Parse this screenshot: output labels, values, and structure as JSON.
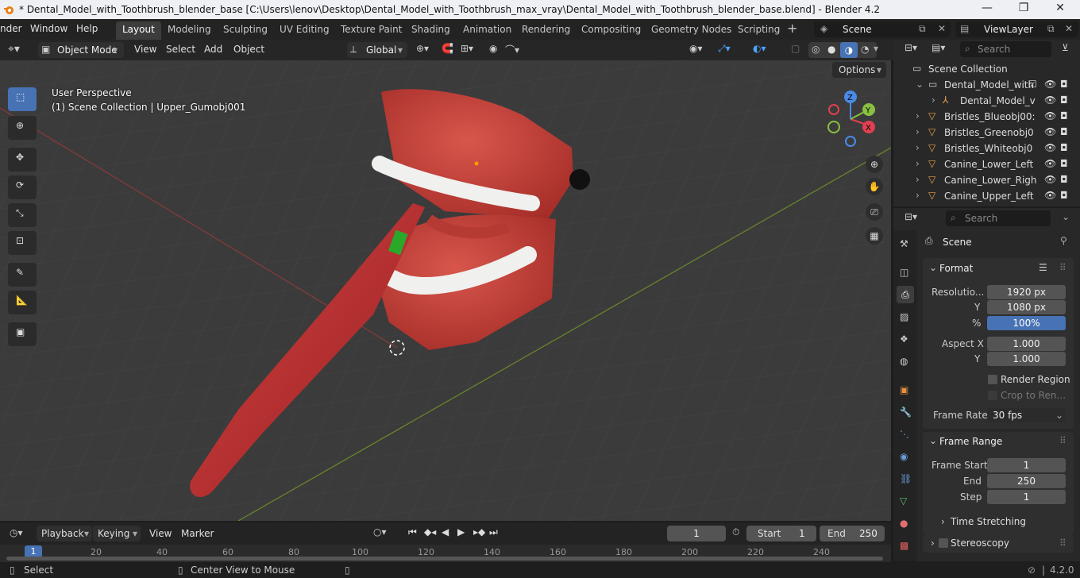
{
  "window": {
    "title": "* Dental_Model_with_Toothbrush_blender_base [C:\\Users\\lenov\\Desktop\\Dental_Model_with_Toothbrush_max_vray\\Dental_Model_with_Toothbrush_blender_base.blend] - Blender 4.2",
    "minimize": "—",
    "maximize": "❐",
    "close": "✕"
  },
  "menu": {
    "items": [
      "nder",
      "Window",
      "Help"
    ]
  },
  "workspaces": [
    "Layout",
    "Modeling",
    "Sculpting",
    "UV Editing",
    "Texture Paint",
    "Shading",
    "Animation",
    "Rendering",
    "Compositing",
    "Geometry Nodes",
    "Scripting"
  ],
  "scene": {
    "label": "Scene",
    "view_layer": "ViewLayer"
  },
  "viewport_header": {
    "mode": "Object Mode",
    "menus": [
      "View",
      "Select",
      "Add",
      "Object"
    ],
    "orientation": "Global",
    "options": "Options"
  },
  "viewport": {
    "perspective": "User Perspective",
    "collection_info": "(1) Scene Collection | Upper_Gumobj001"
  },
  "outliner": {
    "search_placeholder": "Search",
    "root": "Scene Collection",
    "rows": [
      "Dental_Model_with",
      "Dental_Model_v",
      "Bristles_Blueobj00:",
      "Bristles_Greenobj0",
      "Bristles_Whiteobj0",
      "Canine_Lower_Left",
      "Canine_Lower_Righ",
      "Canine_Upper_Left"
    ]
  },
  "properties": {
    "search_placeholder": "Search",
    "scene_label": "Scene",
    "format": {
      "title": "Format",
      "res_label": "Resolutio...",
      "res_x": "1920 px",
      "y_label": "Y",
      "res_y": "1080 px",
      "pct_label": "%",
      "pct": "100%",
      "aspect_label": "Aspect X",
      "aspect_x": "1.000",
      "aspect_y_label": "Y",
      "aspect_y": "1.000",
      "render_region": "Render Region",
      "crop": "Crop to Ren...",
      "frame_rate_label": "Frame Rate",
      "frame_rate": "30 fps"
    },
    "frame_range": {
      "title": "Frame Range",
      "start_label": "Frame Start",
      "start": "1",
      "end_label": "End",
      "end": "250",
      "step_label": "Step",
      "step": "1"
    },
    "time_stretching": "Time Stretching",
    "stereoscopy": "Stereoscopy"
  },
  "timeline": {
    "menus": [
      "Playback",
      "Keying",
      "View",
      "Marker"
    ],
    "current_frame": "1",
    "start_label": "Start",
    "start": "1",
    "end_label": "End",
    "end": "250",
    "ticks": [
      "1",
      "20",
      "40",
      "60",
      "80",
      "100",
      "120",
      "140",
      "160",
      "180",
      "200",
      "220",
      "240"
    ]
  },
  "status": {
    "select": "Select",
    "center": "Center View to Mouse",
    "version": "4.2.0"
  },
  "colors": {
    "accent": "#4772b3",
    "gum": "#c8403a",
    "brush": "#b52a2a"
  }
}
